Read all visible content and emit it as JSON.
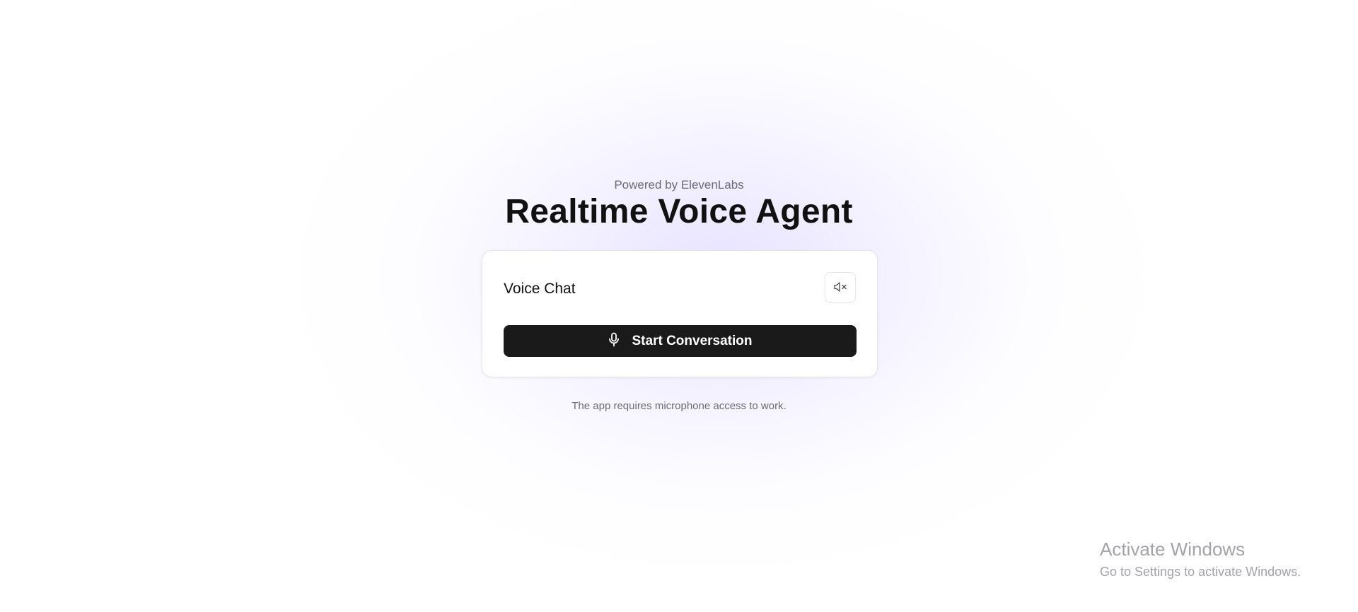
{
  "header": {
    "powered_by": "Powered by ElevenLabs",
    "title": "Realtime Voice Agent"
  },
  "card": {
    "title": "Voice Chat",
    "mute_icon": "speaker-muted-icon",
    "start_button": {
      "icon": "microphone-icon",
      "label": "Start Conversation"
    }
  },
  "footer": {
    "note": "The app requires microphone access to work."
  },
  "os_overlay": {
    "title": "Activate Windows",
    "subtitle": "Go to Settings to activate Windows."
  },
  "colors": {
    "button_bg": "#1a1a1a",
    "glow": "#e2ddff",
    "muted_text": "#6b6b76"
  }
}
